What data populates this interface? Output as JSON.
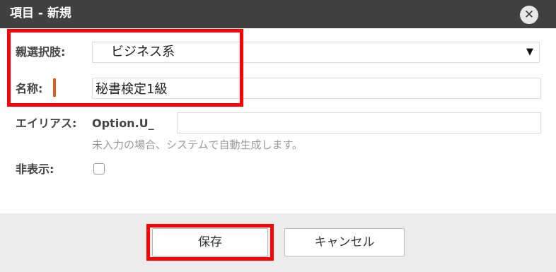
{
  "dialog": {
    "title": "項目 - 新規",
    "close_glyph": "✕"
  },
  "form": {
    "parent_choice": {
      "label": "親選択肢:",
      "value": "ビジネス系",
      "arrow_glyph": "▼"
    },
    "name": {
      "label": "名称:",
      "value": "秘書検定1級",
      "required_color": "#e05a1c"
    },
    "alias": {
      "label": "エイリアス:",
      "prefix": "Option.U_",
      "value": "",
      "hint": "未入力の場合、システムで自動生成します。"
    },
    "hidden": {
      "label": "非表示:",
      "checked": false
    }
  },
  "footer": {
    "save_label": "保存",
    "cancel_label": "キャンセル"
  },
  "colors": {
    "titlebar": "#414141",
    "footer": "#ececec",
    "highlight": "#ff0000"
  }
}
